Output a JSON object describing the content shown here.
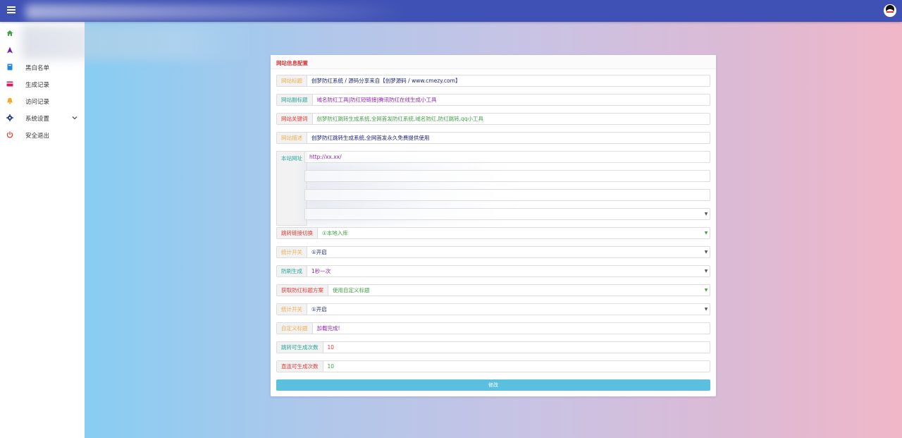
{
  "header": {
    "menu_icon": "hamburger-icon",
    "avatar_icon": "qq-penguin-icon",
    "brand_color": "#3f51b5"
  },
  "sidebar": {
    "items": [
      {
        "label": "",
        "icon": "home-icon",
        "color": "#43a047"
      },
      {
        "label": "",
        "icon": "navigation-arrow-icon",
        "color": "#7b1fa2"
      },
      {
        "label": "黑白名单",
        "icon": "book-icon",
        "color": "#1e88e5"
      },
      {
        "label": "生成记录",
        "icon": "credit-card-icon",
        "color": "#d81b60"
      },
      {
        "label": "访问记录",
        "icon": "bell-icon",
        "color": "#f9a825"
      },
      {
        "label": "系统设置",
        "icon": "gear-icon",
        "color": "#1e3a8a"
      },
      {
        "label": "安全退出",
        "icon": "power-icon",
        "color": "#e53935"
      }
    ]
  },
  "card": {
    "title": "网站信息配置",
    "fields": [
      {
        "label": "网站标题",
        "value": "创梦防红系统 / 源码分享来自【创梦源码 / www.cmezy.com】"
      },
      {
        "label": "网站副标题",
        "value": "域名防红工具|防红短链接|腾讯防红在线生成小工具"
      },
      {
        "label": "网站关键词",
        "value": "创梦防红跳转生成系统,全网首发防红系统,域名防红,防红跳转,qq小工具"
      },
      {
        "label": "网站描述",
        "value": "创梦防红跳转生成系统,全网首发永久免费提供使用"
      },
      {
        "label": "本站网址",
        "value": "http://xx.xx/"
      },
      {
        "label": "跳转链接切换",
        "value": "①本地入库"
      },
      {
        "label": "统计开关",
        "value": "①开启"
      },
      {
        "label": "防刷生成",
        "value": "1秒一次"
      },
      {
        "label": "获取防红标题方案",
        "value": "使用自定义标题"
      },
      {
        "label": "统计开关",
        "value": "①开启"
      },
      {
        "label": "自定义标题",
        "value": "加载完成!"
      },
      {
        "label": "跳转可生成次数",
        "value": "10"
      },
      {
        "label": "直连可生成次数",
        "value": "10"
      }
    ],
    "submit_label": "修改"
  }
}
